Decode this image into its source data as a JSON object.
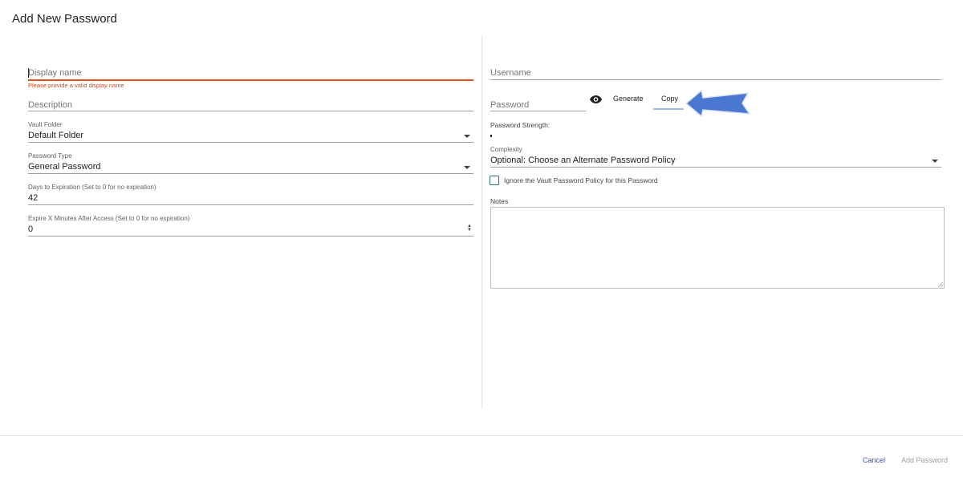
{
  "dialog": {
    "title": "Add New Password"
  },
  "left": {
    "display_name": {
      "placeholder": "Display name",
      "error": "Please provide a valid display name"
    },
    "description": {
      "placeholder": "Description"
    },
    "vault_folder": {
      "label": "Vault Folder",
      "value": "Default Folder"
    },
    "password_type": {
      "label": "Password Type",
      "value": "General Password"
    },
    "days_to_expiration": {
      "label": "Days to Expiration (Set to 0 for no expiration)",
      "value": "42"
    },
    "expire_minutes": {
      "label": "Expire X Minutes After Access (Set to 0 for no expiration)",
      "value": "0"
    }
  },
  "right": {
    "username": {
      "placeholder": "Username"
    },
    "password": {
      "placeholder": "Password"
    },
    "generate_label": "Generate",
    "copy_label": "Copy",
    "strength_label": "Password Strength:",
    "complexity": {
      "label": "Complexity",
      "value": "Optional: Choose an Alternate Password Policy"
    },
    "ignore_policy_label": "Ignore the Vault Password Policy for this Password",
    "ignore_policy_checked": false,
    "notes_label": "Notes"
  },
  "footer": {
    "cancel_label": "Cancel",
    "add_label": "Add Password"
  },
  "colors": {
    "accent": "#3f51b5",
    "error": "#e64a19",
    "arrow": "#4a78d0",
    "checkbox": "#2e7d76"
  }
}
